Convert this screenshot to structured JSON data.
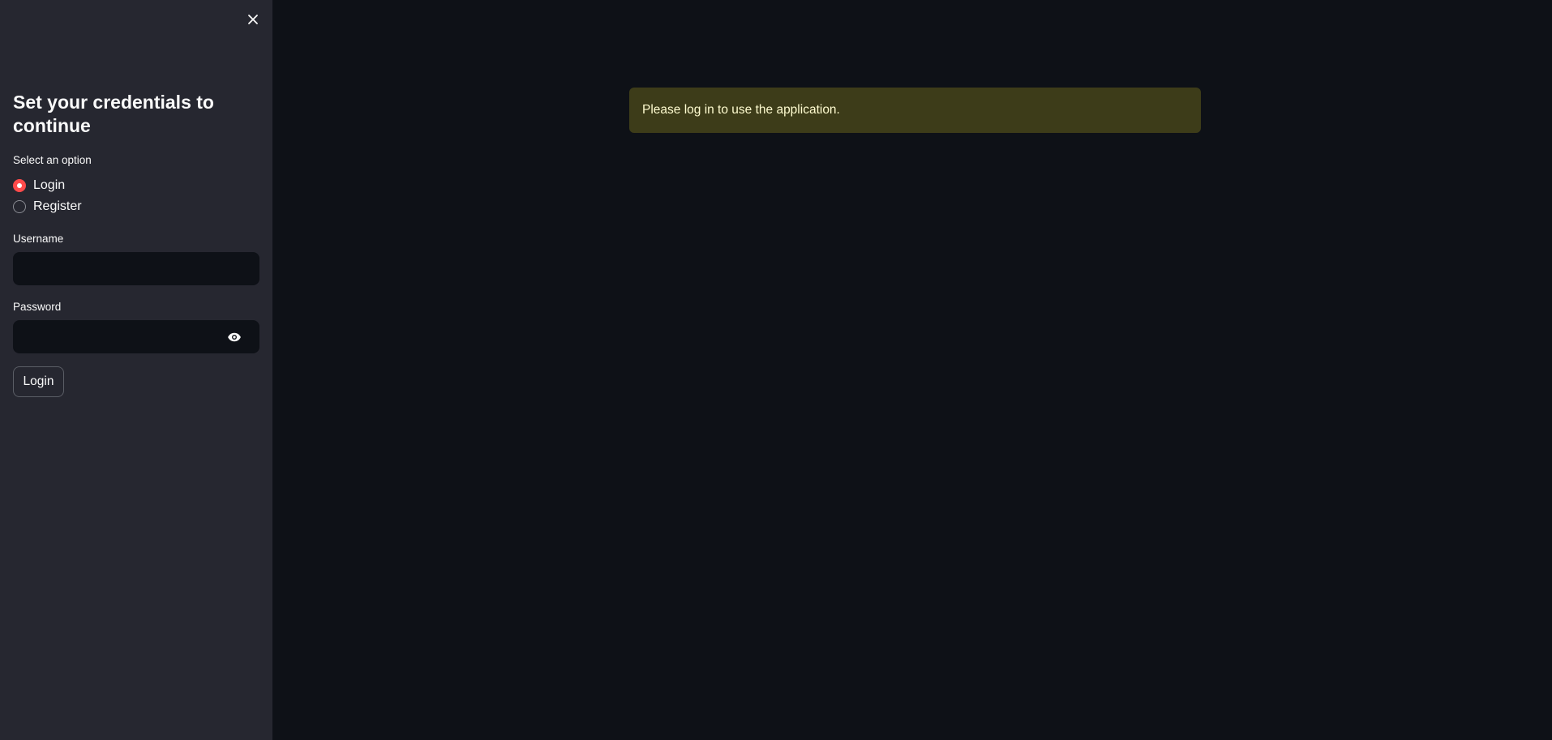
{
  "sidebar": {
    "close_icon": "close-icon",
    "title": "Set your credentials to continue",
    "radio_group": {
      "label": "Select an option",
      "options": [
        {
          "label": "Login",
          "selected": true
        },
        {
          "label": "Register",
          "selected": false
        }
      ]
    },
    "username": {
      "label": "Username",
      "value": "",
      "placeholder": ""
    },
    "password": {
      "label": "Password",
      "value": "",
      "placeholder": "",
      "toggle_icon": "eye-icon"
    },
    "submit_label": "Login"
  },
  "main": {
    "alert": {
      "text": "Please log in to use the application."
    }
  },
  "colors": {
    "sidebar_bg": "#262730",
    "main_bg": "#0e1117",
    "accent": "#ff4b4b",
    "warning_bg": "#3d3c19",
    "warning_text": "#fffcd0"
  }
}
